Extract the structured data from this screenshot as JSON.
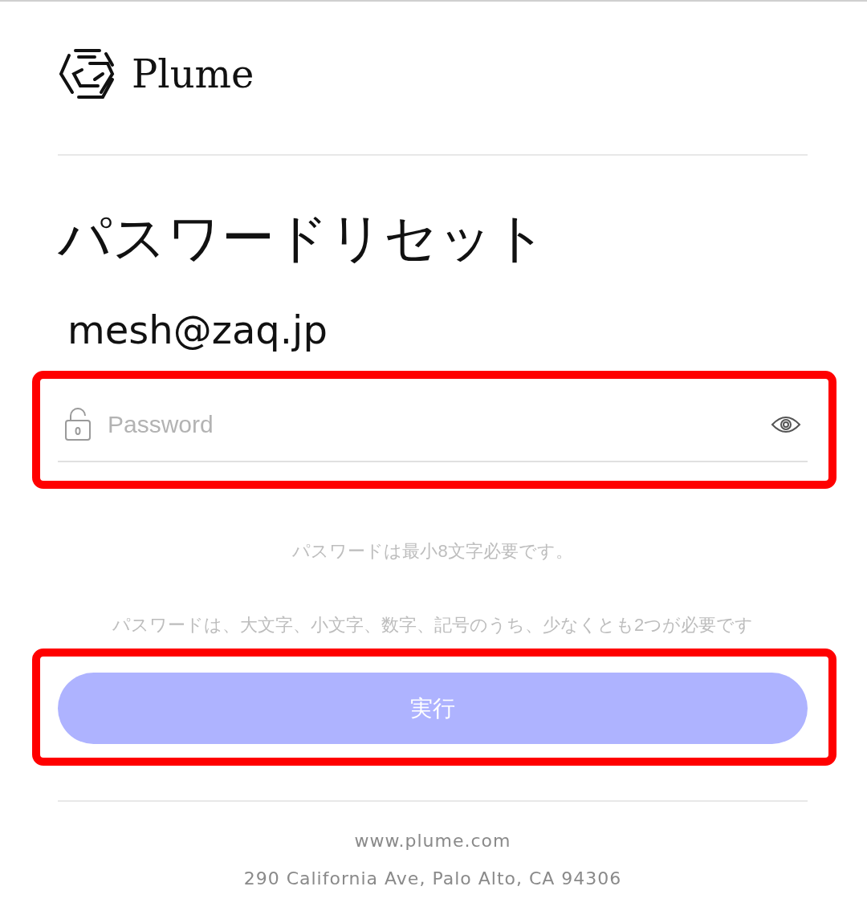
{
  "brand": {
    "name": "Plume"
  },
  "title": "パスワードリセット",
  "email": "mesh@zaq.jp",
  "password_field": {
    "placeholder": "Password",
    "highlighted": true
  },
  "hints": [
    "パスワードは最小8文字必要です。",
    "パスワードは、大文字、小文字、数字、記号のうち、少なくとも2つが必要です"
  ],
  "submit_button": {
    "label": "実行",
    "disabled": true,
    "highlighted": true
  },
  "footer": {
    "website": "www.plume.com",
    "address": "290 California Ave, Palo Alto, CA 94306"
  }
}
